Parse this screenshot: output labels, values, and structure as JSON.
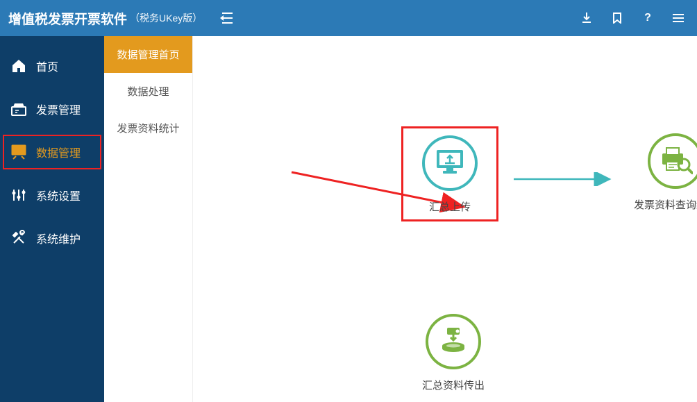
{
  "header": {
    "title": "增值税发票开票软件",
    "subtitle": "（税务UKey版）"
  },
  "nav": {
    "items": [
      {
        "label": "首页",
        "icon": "home"
      },
      {
        "label": "发票管理",
        "icon": "invoice"
      },
      {
        "label": "数据管理",
        "icon": "data",
        "active": true
      },
      {
        "label": "系统设置",
        "icon": "settings"
      },
      {
        "label": "系统维护",
        "icon": "maintain"
      }
    ]
  },
  "subnav": {
    "items": [
      {
        "label": "数据管理首页",
        "active": true
      },
      {
        "label": "数据处理"
      },
      {
        "label": "发票资料统计"
      }
    ]
  },
  "tiles": {
    "upload": {
      "label": "汇总上传"
    },
    "query": {
      "label": "发票资料查询统计"
    },
    "export": {
      "label": "汇总资料传出"
    }
  },
  "colors": {
    "topbar": "#2c7ab6",
    "sidebar": "#0e3e68",
    "accent": "#e39a1e",
    "teal": "#3fb7bb",
    "green": "#7cb342",
    "highlight": "#e22222"
  }
}
